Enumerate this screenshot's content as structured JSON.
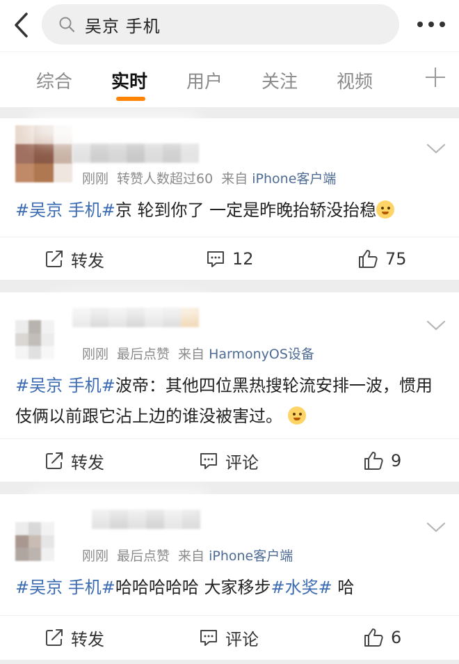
{
  "header": {
    "search_query": "吴京 手机",
    "back_icon": "back-chevron-icon",
    "more_icon": "more-dots-icon"
  },
  "tabs": [
    {
      "label": "综合",
      "active": false
    },
    {
      "label": "实时",
      "active": true
    },
    {
      "label": "用户",
      "active": false
    },
    {
      "label": "关注",
      "active": false
    },
    {
      "label": "视频",
      "active": false
    }
  ],
  "colors": {
    "accent": "#ff8200",
    "link": "#3b6bb3",
    "source": "#4d6b94"
  },
  "posts": [
    {
      "time": "刚刚",
      "status": "转赞人数超过60",
      "from_label": "来自",
      "source": "iPhone客户端",
      "tag1": "#吴京 手机#",
      "text": "京 轮到你了 一定是昨晚抬轿没抬稳",
      "emoji": "doge-emoji",
      "repost_label": "转发",
      "comment_label": "12",
      "like_count": "75"
    },
    {
      "time": "刚刚",
      "status": "最后点赞",
      "from_label": "来自",
      "source": "HarmonyOS设备",
      "tag1": "#吴京 手机#",
      "text": "波帝：其他四位黑热搜轮流安排一波，惯用伎俩以前跟它沾上边的谁没被害过。",
      "emoji": "shush-emoji",
      "repost_label": "转发",
      "comment_label": "评论",
      "like_count": "9"
    },
    {
      "time": "刚刚",
      "status": "最后点赞",
      "from_label": "来自",
      "source": "iPhone客户端",
      "tag1": "#吴京 手机#",
      "text": "哈哈哈哈哈 大家移步",
      "tag2": "#水奖#",
      "text2": " 哈",
      "repost_label": "转发",
      "comment_label": "评论",
      "like_count": "6"
    }
  ]
}
